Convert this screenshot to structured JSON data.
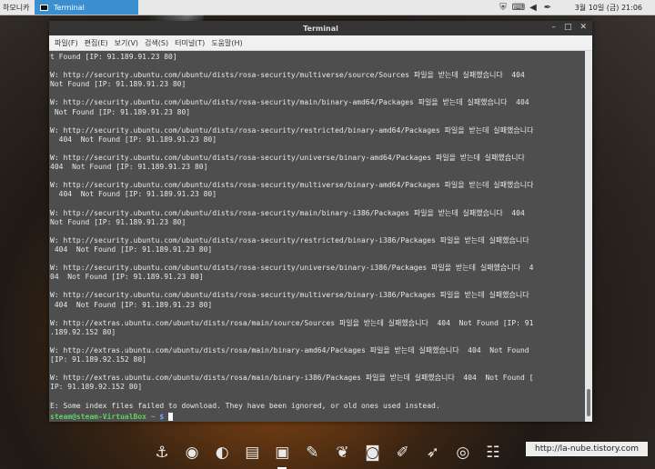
{
  "top_panel": {
    "menu_label": "하모니카",
    "task_label": "Terminal",
    "clock": "3월 10일 (금) 21:06"
  },
  "window": {
    "title": "Terminal",
    "controls": [
      "–",
      "□",
      "✕"
    ],
    "menu": [
      "파일(F)",
      "편집(E)",
      "보기(V)",
      "검색(S)",
      "터미널(T)",
      "도움말(H)"
    ]
  },
  "terminal": {
    "lines": [
      "t Found [IP: 91.189.91.23 80]",
      "",
      "W: http://security.ubuntu.com/ubuntu/dists/rosa-security/multiverse/source/Sources 파일을 받는데 실패했습니다  404",
      "Not Found [IP: 91.189.91.23 80]",
      "",
      "W: http://security.ubuntu.com/ubuntu/dists/rosa-security/main/binary-amd64/Packages 파일을 받는데 실패했습니다  404",
      " Not Found [IP: 91.189.91.23 80]",
      "",
      "W: http://security.ubuntu.com/ubuntu/dists/rosa-security/restricted/binary-amd64/Packages 파일을 받는데 실패했습니다",
      "  404  Not Found [IP: 91.189.91.23 80]",
      "",
      "W: http://security.ubuntu.com/ubuntu/dists/rosa-security/universe/binary-amd64/Packages 파일을 받는데 실패했습니다",
      "404  Not Found [IP: 91.189.91.23 80]",
      "",
      "W: http://security.ubuntu.com/ubuntu/dists/rosa-security/multiverse/binary-amd64/Packages 파일을 받는데 실패했습니다",
      "  404  Not Found [IP: 91.189.91.23 80]",
      "",
      "W: http://security.ubuntu.com/ubuntu/dists/rosa-security/main/binary-i386/Packages 파일을 받는데 실패했습니다  404",
      "Not Found [IP: 91.189.91.23 80]",
      "",
      "W: http://security.ubuntu.com/ubuntu/dists/rosa-security/restricted/binary-i386/Packages 파일을 받는데 실패했습니다",
      " 404  Not Found [IP: 91.189.91.23 80]",
      "",
      "W: http://security.ubuntu.com/ubuntu/dists/rosa-security/universe/binary-i386/Packages 파일을 받는데 실패했습니다  4",
      "04  Not Found [IP: 91.189.91.23 80]",
      "",
      "W: http://security.ubuntu.com/ubuntu/dists/rosa-security/multiverse/binary-i386/Packages 파일을 받는데 실패했습니다",
      " 404  Not Found [IP: 91.189.91.23 80]",
      "",
      "W: http://extras.ubuntu.com/ubuntu/dists/rosa/main/source/Sources 파일을 받는데 실패했습니다  404  Not Found [IP: 91",
      ".189.92.152 80]",
      "",
      "W: http://extras.ubuntu.com/ubuntu/dists/rosa/main/binary-amd64/Packages 파일을 받는데 실패했습니다  404  Not Found",
      "[IP: 91.189.92.152 80]",
      "",
      "W: http://extras.ubuntu.com/ubuntu/dists/rosa/main/binary-i386/Packages 파일을 받는데 실패했습니다  404  Not Found [",
      "IP: 91.189.92.152 80]",
      "",
      "E: Some index files failed to download. They have been ignored, or old ones used instead."
    ],
    "prompt_user": "steam@steam-VirtualBox",
    "prompt_path": " ~ $ "
  },
  "dock": {
    "items": [
      {
        "icon": "anchor-icon",
        "glyph": "⚓"
      },
      {
        "icon": "firefox-icon",
        "glyph": "◉"
      },
      {
        "icon": "browser-globe-icon",
        "glyph": "◐"
      },
      {
        "icon": "file-cabinet-icon",
        "glyph": "▤"
      },
      {
        "icon": "terminal-icon",
        "glyph": "▣"
      },
      {
        "icon": "paint-palette-icon",
        "glyph": "✎"
      },
      {
        "icon": "leaf-icon",
        "glyph": "❦"
      },
      {
        "icon": "camera-icon",
        "glyph": "◙"
      },
      {
        "icon": "brush-tool-icon",
        "glyph": "✐"
      },
      {
        "icon": "rocket-icon",
        "glyph": "➶"
      },
      {
        "icon": "target-settings-icon",
        "glyph": "◎"
      },
      {
        "icon": "equalizer-icon",
        "glyph": "☷"
      }
    ]
  },
  "watermark": "http://la-nube.tistory.com"
}
